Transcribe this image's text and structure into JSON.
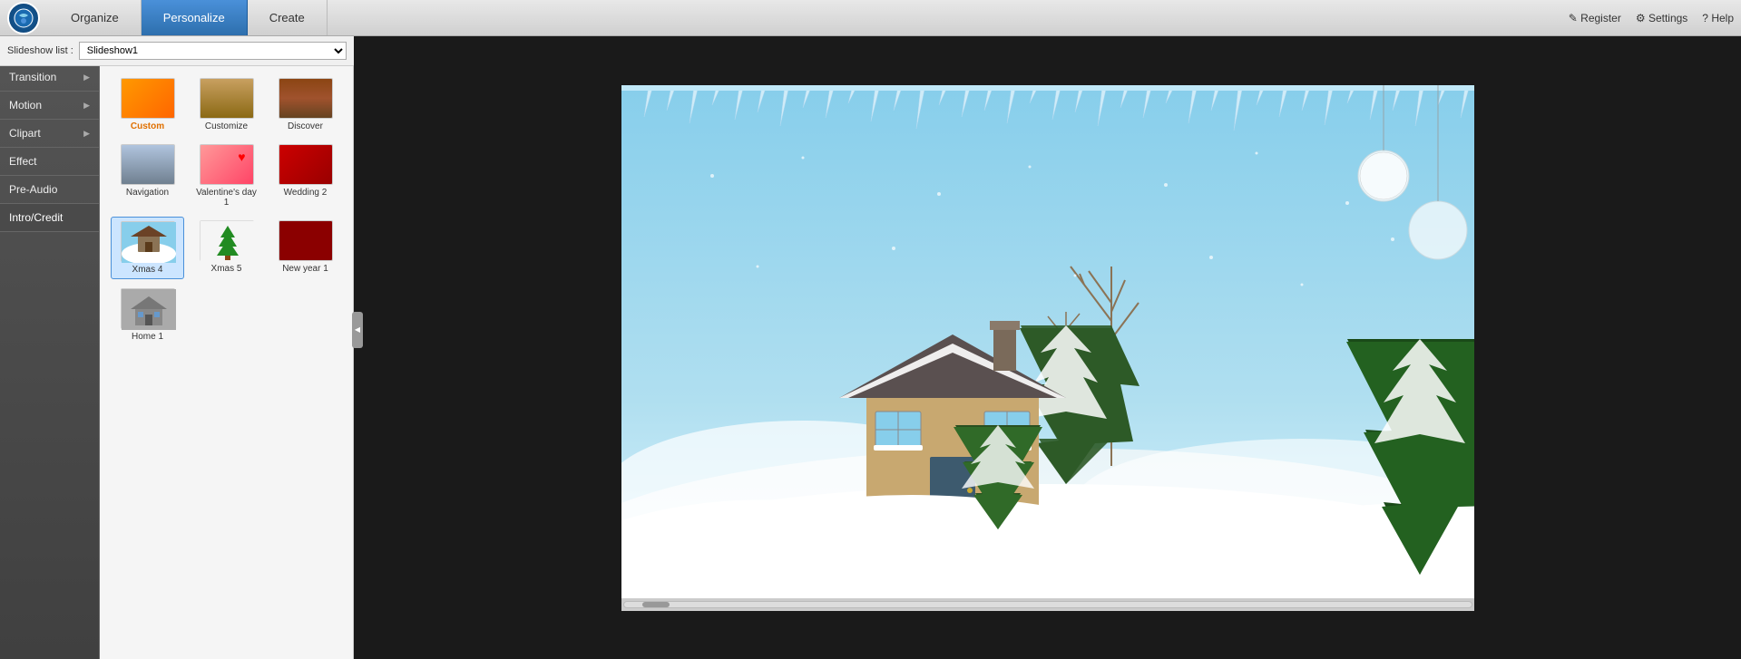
{
  "topbar": {
    "tabs": [
      {
        "label": "Organize",
        "active": false
      },
      {
        "label": "Personalize",
        "active": true
      },
      {
        "label": "Create",
        "active": false
      }
    ],
    "right_actions": [
      {
        "label": "Register",
        "icon": "register-icon"
      },
      {
        "label": "Settings",
        "icon": "settings-icon"
      },
      {
        "label": "Help",
        "icon": "help-icon"
      }
    ]
  },
  "slideshow_bar": {
    "label": "Slideshow list :",
    "value": "Slideshow1"
  },
  "sidebar": {
    "items": [
      {
        "label": "Transition",
        "has_arrow": true,
        "active": false
      },
      {
        "label": "Motion",
        "has_arrow": true,
        "active": false
      },
      {
        "label": "Clipart",
        "has_arrow": true,
        "active": false
      },
      {
        "label": "Effect",
        "has_arrow": false,
        "active": false
      },
      {
        "label": "Pre-Audio",
        "has_arrow": false,
        "active": false
      },
      {
        "label": "Intro/Credit",
        "has_arrow": false,
        "active": true
      }
    ]
  },
  "themes": {
    "items": [
      {
        "id": "custom",
        "label": "Custom",
        "is_custom": true,
        "selected": false
      },
      {
        "id": "customize",
        "label": "Customize",
        "is_custom": false,
        "selected": false
      },
      {
        "id": "discover",
        "label": "Discover",
        "is_custom": false,
        "selected": false
      },
      {
        "id": "navigation",
        "label": "Navigation",
        "is_custom": false,
        "selected": false
      },
      {
        "id": "valentines",
        "label": "Valentine's day 1",
        "is_custom": false,
        "selected": false
      },
      {
        "id": "wedding2",
        "label": "Wedding 2",
        "is_custom": false,
        "selected": false
      },
      {
        "id": "xmas4",
        "label": "Xmas 4",
        "is_custom": false,
        "selected": true
      },
      {
        "id": "xmas5",
        "label": "Xmas 5",
        "is_custom": false,
        "selected": false
      },
      {
        "id": "newyear",
        "label": "New year 1",
        "is_custom": false,
        "selected": false
      },
      {
        "id": "home",
        "label": "Home 1",
        "is_custom": false,
        "selected": false
      }
    ]
  },
  "preview": {
    "scene": "winter_xmas"
  },
  "icons": {
    "register": "✎",
    "settings": "⚙",
    "help": "?",
    "arrow_right": "▶",
    "collapse": "◀"
  }
}
